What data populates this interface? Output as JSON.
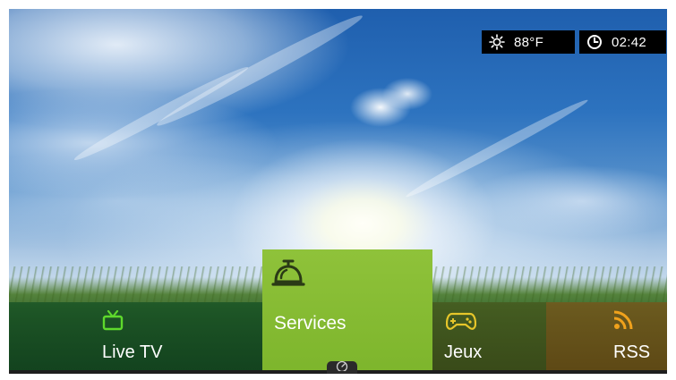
{
  "status": {
    "weather_icon": "sun-icon",
    "temperature": "88°F",
    "clock_icon": "clock-icon",
    "time": "02:42"
  },
  "menu": {
    "items": [
      {
        "label": "Live TV",
        "icon": "tv-icon",
        "color": "#5ed92c"
      },
      {
        "label": "Services",
        "icon": "service-bell-icon",
        "color": "#2a3a16",
        "selected": true
      },
      {
        "label": "Jeux",
        "icon": "gamepad-icon",
        "color": "#e6c62a"
      },
      {
        "label": "RSS",
        "icon": "rss-icon",
        "color": "#f0a21c"
      }
    ]
  },
  "footer": {
    "icon": "gauge-icon"
  },
  "colors": {
    "selected_tile": "#8fc23a",
    "status_bg": "#000000"
  }
}
